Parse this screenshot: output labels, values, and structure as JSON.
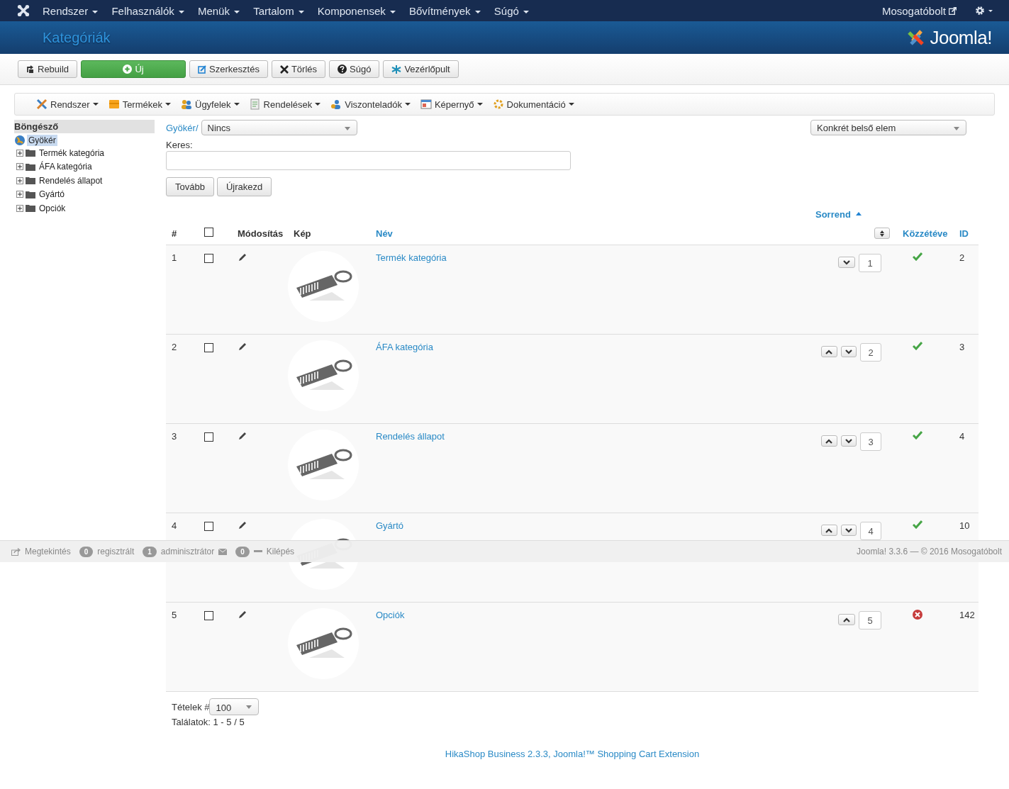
{
  "top_menu": {
    "items": [
      "Rendszer",
      "Felhasználók",
      "Menük",
      "Tartalom",
      "Komponensek",
      "Bővítmények",
      "Súgó"
    ],
    "site_link": "Mosogatóbolt"
  },
  "header": {
    "title": "Kategóriák",
    "logo_text": "Joomla!"
  },
  "toolbar": [
    {
      "label": "Rebuild",
      "kind": "rebuild"
    },
    {
      "label": "Új",
      "kind": "new"
    },
    {
      "label": "Szerkesztés",
      "kind": "edit"
    },
    {
      "label": "Törlés",
      "kind": "delete"
    },
    {
      "label": "Súgó",
      "kind": "help"
    },
    {
      "label": "Vezérlőpult",
      "kind": "dashboard"
    }
  ],
  "submenu": [
    {
      "label": "Rendszer",
      "kind": "tools"
    },
    {
      "label": "Termékek",
      "kind": "box"
    },
    {
      "label": "Ügyfelek",
      "kind": "users"
    },
    {
      "label": "Rendelések",
      "kind": "orders"
    },
    {
      "label": "Viszonteladók",
      "kind": "partners"
    },
    {
      "label": "Képernyő",
      "kind": "display"
    },
    {
      "label": "Dokumentáció",
      "kind": "docs"
    }
  ],
  "tree": {
    "title": "Böngésző",
    "root": {
      "label": "Gyökér",
      "selected": true,
      "children": [
        {
          "label": "Termék kategória",
          "expanded": false
        },
        {
          "label": "ÁFA kategória",
          "expanded": false
        },
        {
          "label": "Rendelés állapot",
          "expanded": false
        },
        {
          "label": "Gyártó",
          "expanded": false
        },
        {
          "label": "Opciók",
          "expanded": false
        }
      ]
    }
  },
  "filters": {
    "breadcrumb": "Gyökér/",
    "parent_select": "Nincs",
    "search_label": "Keres:",
    "buttons": [
      "Tovább",
      "Újrakezd"
    ],
    "depth_select": "Konkrét belső elem"
  },
  "table": {
    "columns": [
      "#",
      "Módosítás",
      "Kép",
      "Név",
      "Sorrend",
      "Közzétéve",
      "ID"
    ],
    "select_all_checked": false,
    "rows": [
      {
        "num": "1",
        "name": "Termék kategória",
        "order": "1",
        "published": true,
        "id": "2",
        "checked": false,
        "can_up": false,
        "can_down": true
      },
      {
        "num": "2",
        "name": "ÁFA kategória",
        "order": "2",
        "published": true,
        "id": "3",
        "checked": false,
        "can_up": true,
        "can_down": true
      },
      {
        "num": "3",
        "name": "Rendelés állapot",
        "order": "3",
        "published": true,
        "id": "4",
        "checked": false,
        "can_up": true,
        "can_down": true
      },
      {
        "num": "4",
        "name": "Gyártó",
        "order": "4",
        "published": true,
        "id": "10",
        "checked": false,
        "can_up": true,
        "can_down": true
      },
      {
        "num": "5",
        "name": "Opciók",
        "order": "5",
        "published": false,
        "id": "142",
        "checked": false,
        "can_up": true,
        "can_down": false
      }
    ]
  },
  "list_footer": {
    "limit_label": "Tételek #",
    "limit": "100",
    "results": "Találatok: 1 - 5 / 5",
    "credit": "HikaShop Business 2.3.3, Joomla!™ Shopping Cart Extension"
  },
  "status_bar": {
    "preview": "Megtekintés",
    "registered_count": "0",
    "registered": "regisztrált",
    "admin_count": "1",
    "admin": "adminisztrátor",
    "messages_count": "0",
    "logout": "Kilépés",
    "version": "Joomla! 3.3.6 — © 2016 Mosogatóbolt"
  }
}
